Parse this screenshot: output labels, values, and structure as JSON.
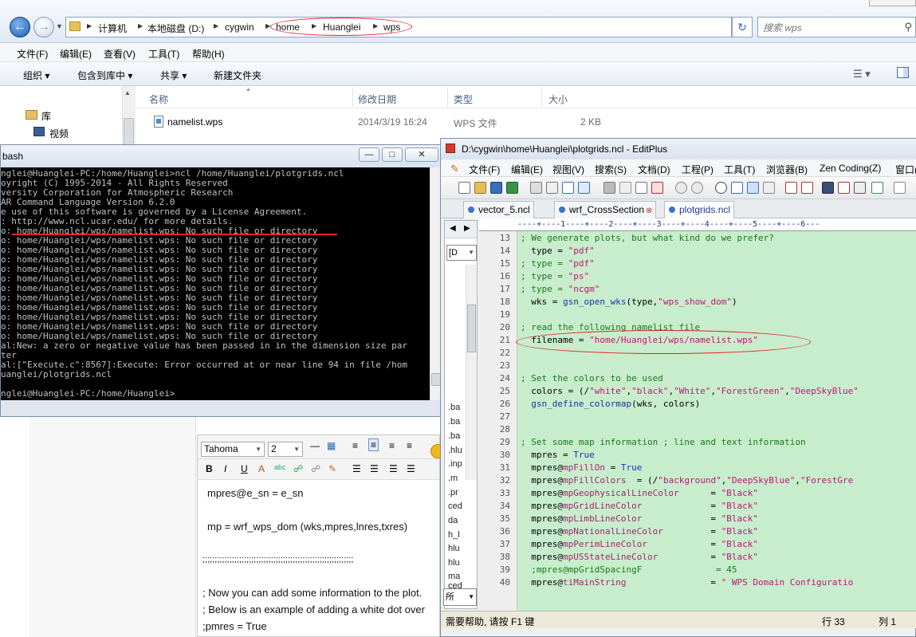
{
  "explorer": {
    "crumbs": [
      "计算机",
      "本地磁盘 (D:)",
      "cygwin",
      "home",
      "Huanglei",
      "wps"
    ],
    "search_placeholder": "搜索 wps",
    "menu": [
      "文件(F)",
      "编辑(E)",
      "查看(V)",
      "工具(T)",
      "帮助(H)"
    ],
    "toolbar": [
      "组织 ▾",
      "包含到库中 ▾",
      "共享 ▾",
      "新建文件夹"
    ],
    "nav": [
      "库",
      "视频"
    ],
    "columns": [
      "名称",
      "修改日期",
      "类型",
      "大小"
    ],
    "file": {
      "name": "namelist.wps",
      "date": "2014/3/19 16:24",
      "type": "WPS 文件",
      "size": "2 KB"
    }
  },
  "bash": {
    "title": "bash",
    "lines": [
      "nglei@Huanglei-PC:/home/Huanglei>ncl /home/Huanglei/plotgrids.ncl",
      "oyright (C) 1995-2014 - All Rights Reserved",
      "versity Corporation for Atmospheric Research",
      "AR Command Language Version 6.2.0",
      "e use of this software is governed by a License Agreement.",
      ": http://www.ncl.ucar.edu/ for more details.",
      "o: home/Huanglei/wps/namelist.wps: No such file or directory",
      "o: home/Huanglei/wps/namelist.wps: No such file or directory",
      "o: home/Huanglei/wps/namelist.wps: No such file or directory",
      "o: home/Huanglei/wps/namelist.wps: No such file or directory",
      "o: home/Huanglei/wps/namelist.wps: No such file or directory",
      "o: home/Huanglei/wps/namelist.wps: No such file or directory",
      "o: home/Huanglei/wps/namelist.wps: No such file or directory",
      "o: home/Huanglei/wps/namelist.wps: No such file or directory",
      "o: home/Huanglei/wps/namelist.wps: No such file or directory",
      "o: home/Huanglei/wps/namelist.wps: No such file or directory",
      "o: home/Huanglei/wps/namelist.wps: No such file or directory",
      "o: home/Huanglei/wps/namelist.wps: No such file or directory",
      "al:New: a zero or negative value has been passed in in the dimension size par",
      "ter",
      "al:[\"Execute.c\":8567]:Execute: Error occurred at or near line 94 in file /hom",
      "uanglei/plotgrids.ncl",
      "",
      "nglei@Huanglei-PC:/home/Huanglei>"
    ]
  },
  "web": {
    "font": "Tahoma",
    "size": "2",
    "lines": [
      "mpres@e_sn            = e_sn",
      "mp = wrf_wps_dom (wks,mpres,lnres,txres)",
      ";;;;;;;;;;;;;;;;;;;;;;;;;;;;;;;;;;;;;;;;;;;;;;;;;;;;;;;;;;;;;;",
      "; Now you can add some information to the plot.",
      "; Below is an example of adding a white dot over",
      "  ;pmres = True"
    ]
  },
  "editplus": {
    "title": "D:\\cygwin\\home\\Huanglei\\plotgrids.ncl - EditPlus",
    "menu": [
      "文件(F)",
      "编辑(E)",
      "视图(V)",
      "搜索(S)",
      "文档(D)",
      "工程(P)",
      "工具(T)",
      "浏览器(B)",
      "Zen Coding(Z)",
      "窗口("
    ],
    "tabs": [
      "vector_5.ncl",
      "wrf_CrossSection",
      "plotgrids.ncl"
    ],
    "ruler": "----+----1----+----2----+----3----+----4----+----5----+----6---",
    "drive": "[D",
    "files": [
      ".ba",
      ".ba",
      ".ba",
      ".hlu",
      ".inp",
      ".m",
      ".pr",
      "ced",
      "da",
      "h_l",
      "hlu",
      "hlu",
      "ma"
    ],
    "bottom_sel": "所",
    "status_help": "需要帮助, 请按 F1 键",
    "status_row": "行 33",
    "status_col": "列 1"
  }
}
